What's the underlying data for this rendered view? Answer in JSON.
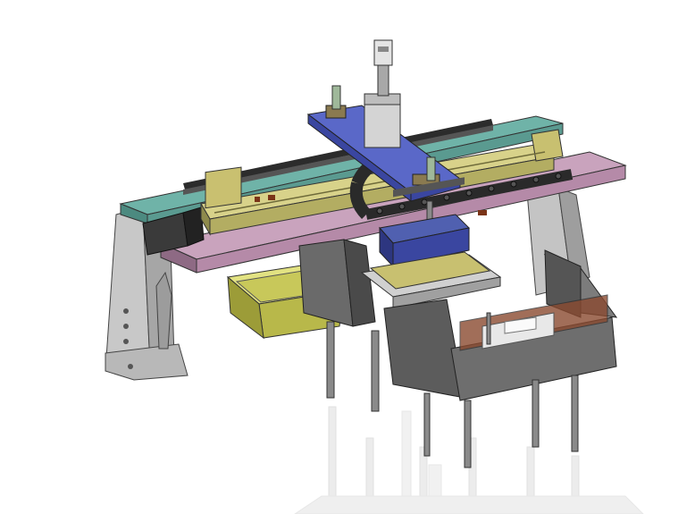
{
  "scene": {
    "kind": "cad-assembly-view",
    "background": "#ffffff",
    "colors": {
      "rail_teal": "#5a9a90",
      "plate_pink": "#b58aa8",
      "plate_blue": "#4a58b0",
      "bracket_olive": "#c8c070",
      "tray_yellow": "#b8b84a",
      "frame_gray": "#9a9a9a",
      "box_dark": "#5c5c5c",
      "rod_gray": "#8a8a8a",
      "accent_brown": "#7a3418"
    }
  }
}
